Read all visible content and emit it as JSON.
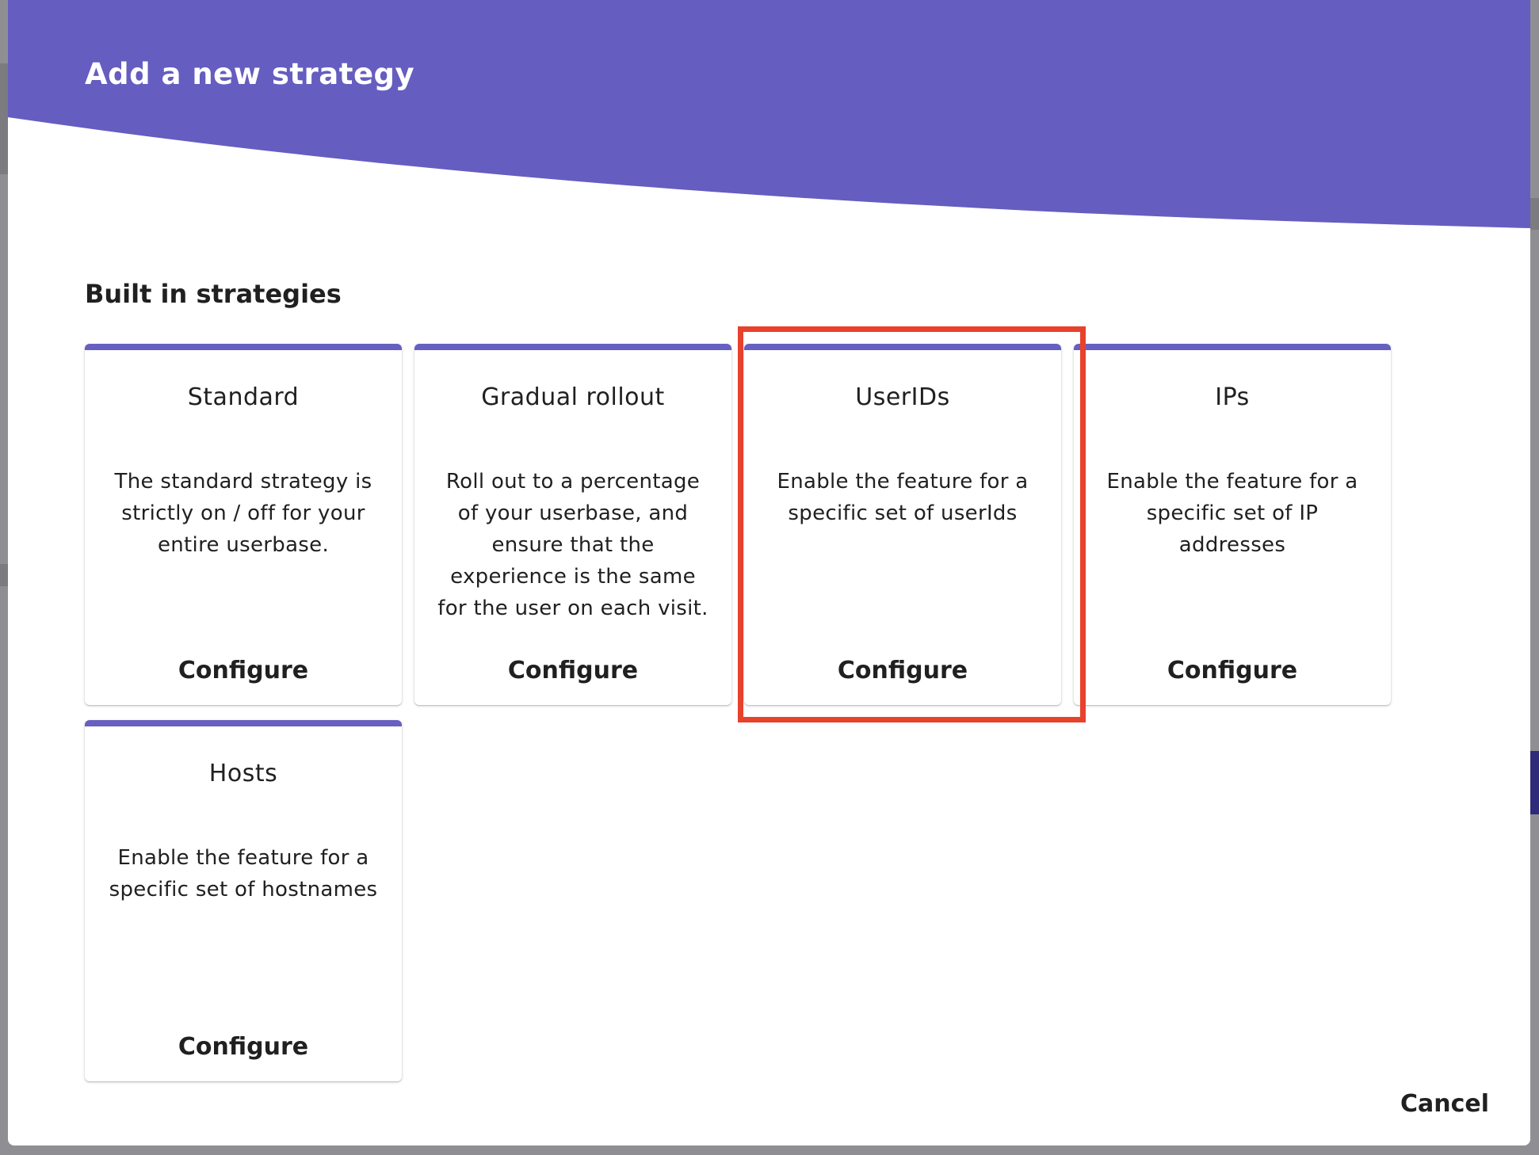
{
  "dialog": {
    "title": "Add a new strategy",
    "section_title": "Built in strategies",
    "cancel_label": "Cancel",
    "accent_color": "#6760c0",
    "highlight_color": "#e8412c"
  },
  "strategies": [
    {
      "title": "Standard",
      "description": "The standard strategy is strictly on / off for your entire userbase.",
      "button": "Configure"
    },
    {
      "title": "Gradual rollout",
      "description": "Roll out to a percentage of your userbase, and ensure that the experience is the same for the user on each visit.",
      "button": "Configure"
    },
    {
      "title": "UserIDs",
      "description": "Enable the feature for a specific set of userIds",
      "button": "Configure",
      "highlighted": true
    },
    {
      "title": "IPs",
      "description": "Enable the feature for a specific set of IP addresses",
      "button": "Configure"
    },
    {
      "title": "Hosts",
      "description": "Enable the feature for a specific set of hostnames",
      "button": "Configure"
    }
  ]
}
